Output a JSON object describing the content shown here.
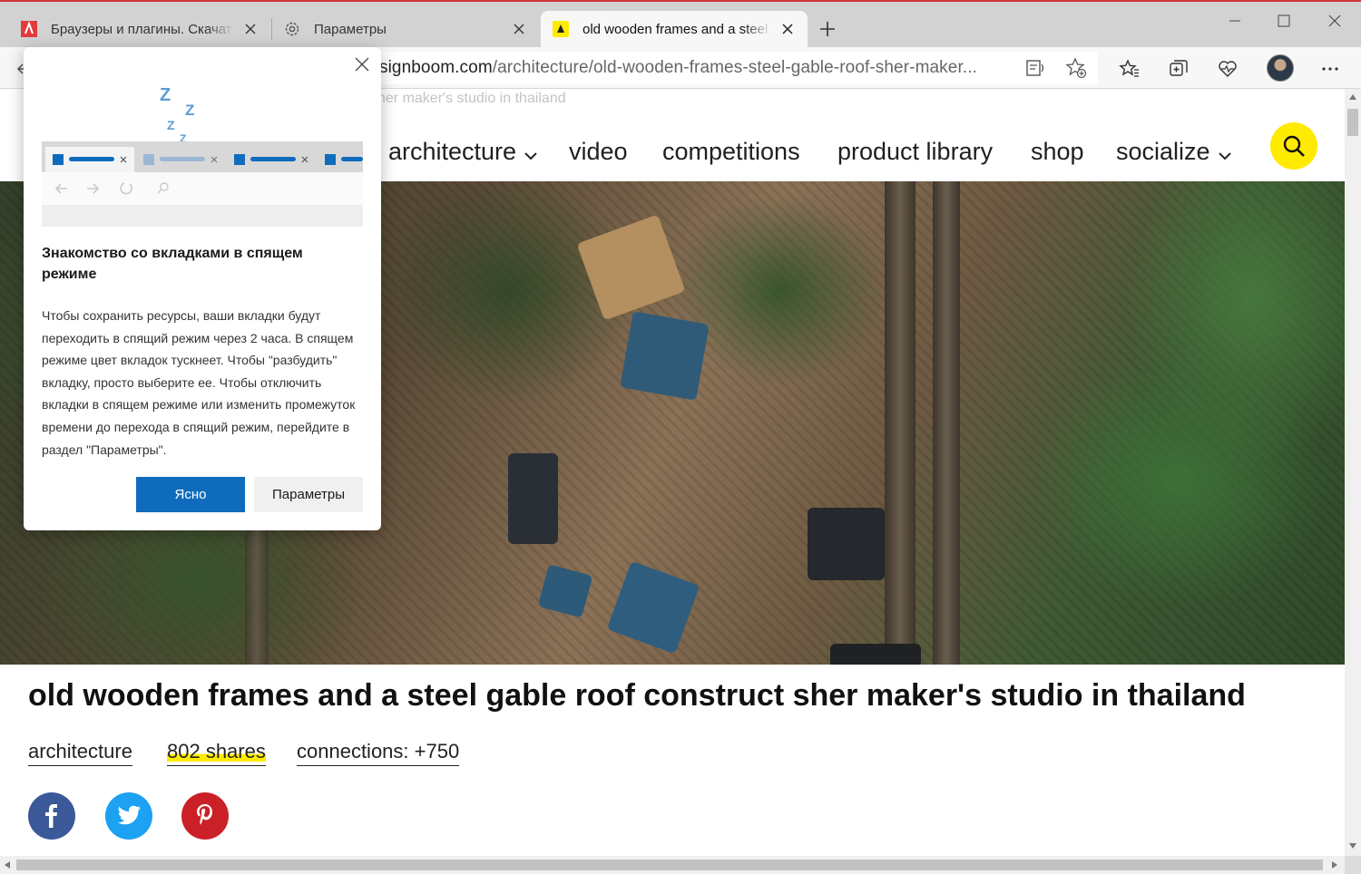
{
  "tabs": [
    {
      "title": "Браузеры и плагины. Скачать бесплатно"
    },
    {
      "title": "Параметры"
    },
    {
      "title": "old wooden frames and a steel gable roof"
    }
  ],
  "address": {
    "domain": "signboom.com",
    "path": "/architecture/old-wooden-frames-steel-gable-roof-sher-maker..."
  },
  "page": {
    "breadcrumb": "her maker's studio in thailand",
    "nav": [
      "architecture",
      "video",
      "competitions",
      "product library",
      "shop",
      "socialize"
    ],
    "title": "old wooden frames and a steel gable roof construct sher maker's studio in thailand",
    "meta": {
      "category": "architecture",
      "shares": "802 shares",
      "connections": "connections: +750"
    }
  },
  "popup": {
    "sleep_letters": "Z",
    "heading": "Знакомство со вкладками в спящем режиме",
    "body": "Чтобы сохранить ресурсы, ваши вкладки будут переходить в спящий режим через 2 часа. В спящем режиме цвет вкладок тускнеет. Чтобы \"разбудить\" вкладку, просто выберите ее. Чтобы отключить вкладки в спящем режиме или изменить промежуток времени до перехода в спящий режим, перейдите в раздел \"Параметры\".",
    "primary_button": "Ясно",
    "secondary_button": "Параметры"
  },
  "social": [
    "f",
    "t",
    "p"
  ],
  "colors": {
    "accent": "#0f6cbd",
    "highlight": "#ffeb00",
    "facebook": "#3b5998",
    "twitter": "#1da1f2",
    "pinterest": "#cb2027"
  }
}
